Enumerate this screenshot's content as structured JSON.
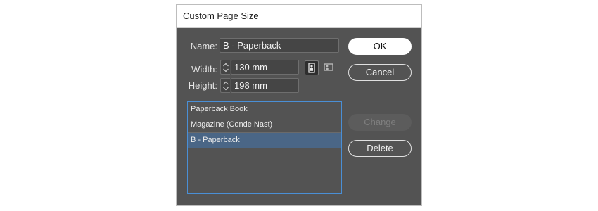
{
  "dialog": {
    "title": "Custom Page Size"
  },
  "form": {
    "name_label": "Name:",
    "name_value": "B - Paperback",
    "width_label": "Width:",
    "width_value": "130 mm",
    "height_label": "Height:",
    "height_value": "198 mm",
    "orientation": "portrait"
  },
  "buttons": {
    "ok": "OK",
    "cancel": "Cancel",
    "change": "Change",
    "delete": "Delete"
  },
  "presets": {
    "items": [
      {
        "label": "Paperback Book"
      },
      {
        "label": "Magazine (Conde Nast)"
      },
      {
        "label": "B - Paperback"
      }
    ],
    "selected_index": 2
  },
  "colors": {
    "background": "#535353",
    "selection": "#4a6686",
    "list_border": "#4a8fd6"
  },
  "icons": {
    "stepper": "up-down-arrows",
    "portrait": "portrait-orientation",
    "landscape": "landscape-orientation"
  }
}
